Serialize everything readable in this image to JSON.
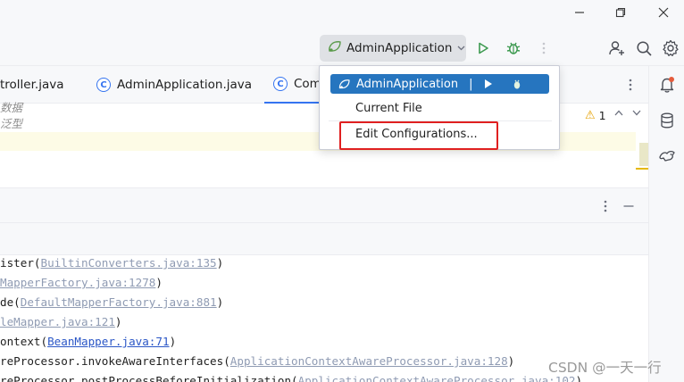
{
  "window": {
    "minimize_icon": "minimize-icon",
    "restore_icon": "restore-icon",
    "close_icon": "close-icon"
  },
  "toolbar": {
    "run_config_label": "AdminApplication",
    "run_config_icon": "spring-boot-icon",
    "run_icon": "run-icon",
    "debug_icon": "debug-icon",
    "more_icon": "more-vertical-icon",
    "add_user_icon": "add-user-icon",
    "search_icon": "search-icon",
    "settings_icon": "gear-icon"
  },
  "tabs": [
    {
      "label": "troller.java",
      "icon": ""
    },
    {
      "label": "AdminApplication.java",
      "icon": "class-icon"
    },
    {
      "label": "Com",
      "icon": "class-icon",
      "active": true
    }
  ],
  "editor": {
    "comment_line_1": "数据",
    "comment_line_2": "泛型",
    "warning_count": "1"
  },
  "console": {
    "lines": [
      {
        "pre": "ister(",
        "link": "BuiltinConverters.java:135",
        "post": ")",
        "style": "muted"
      },
      {
        "pre": "",
        "link": "MapperFactory.java:1278",
        "post": ")",
        "style": "muted"
      },
      {
        "pre": "de(",
        "link": "DefaultMapperFactory.java:881",
        "post": ")",
        "style": "muted"
      },
      {
        "pre": "",
        "link": "leMapper.java:121",
        "post": ")",
        "style": "muted"
      },
      {
        "pre": "ontext(",
        "link": "BeanMapper.java:71",
        "post": ")",
        "style": "blue"
      },
      {
        "pre": "reProcessor.invokeAwareInterfaces(",
        "link": "ApplicationContextAwareProcessor.java:128",
        "post": ")",
        "style": "muted"
      },
      {
        "pre": "reProcessor.postProcessBeforeInitialization(",
        "link": "ApplicationContextAwareProcessor.java:102",
        "post": ")",
        "style": "muted"
      }
    ]
  },
  "popup": {
    "selected_label": "AdminApplication",
    "selected_separator": "|",
    "current_file": "Current File",
    "edit_configurations": "Edit Configurations..."
  },
  "right_strip": {
    "icons": [
      "notifications-icon",
      "database-icon",
      "mybatis-icon"
    ]
  },
  "watermark": "CSDN @一天一行",
  "colors": {
    "accent": "#3574f0",
    "run_green": "#3d9a50",
    "popup_selected": "#2675bf",
    "highlight_red": "#e02020"
  }
}
